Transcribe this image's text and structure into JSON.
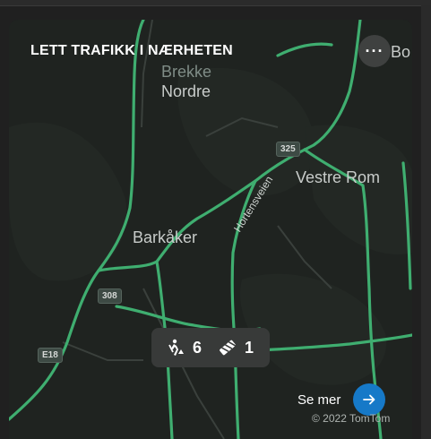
{
  "card": {
    "title": "LETT TRAFIKK I NÆRHETEN",
    "more_label": "···"
  },
  "map": {
    "places": [
      {
        "id": "brekke",
        "text": "Brekke"
      },
      {
        "id": "nordre",
        "text": "Nordre"
      },
      {
        "id": "vestre_rom",
        "text": "Vestre Rom"
      },
      {
        "id": "barkaker",
        "text": "Barkåker"
      },
      {
        "id": "bo",
        "text": "Bo"
      }
    ],
    "road_name": "Hortensveien",
    "shields": [
      {
        "id": "r325",
        "text": "325"
      },
      {
        "id": "r308",
        "text": "308"
      },
      {
        "id": "e18",
        "text": "E18"
      }
    ],
    "copyright": "© 2022 TomTom",
    "road_color": "#3fae70",
    "background_color": "#1f2320"
  },
  "traffic": {
    "roadwork_icon": "roadwork-icon",
    "roadwork_count": "6",
    "closure_icon": "closure-icon",
    "closure_count": "1"
  },
  "footer": {
    "see_more_label": "Se mer",
    "see_more_icon": "arrow-right-icon",
    "accent_color": "#1679c8"
  }
}
